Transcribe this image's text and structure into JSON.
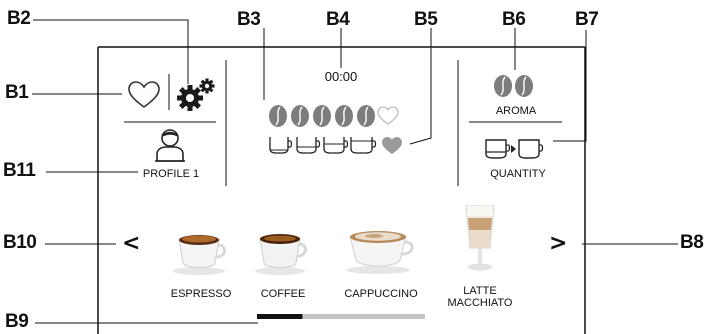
{
  "callouts": {
    "b1": "B1",
    "b2": "B2",
    "b3": "B3",
    "b4": "B4",
    "b5": "B5",
    "b6": "B6",
    "b7": "B7",
    "b8": "B8",
    "b9": "B9",
    "b10": "B10",
    "b11": "B11"
  },
  "screen": {
    "timer": "00:00",
    "profile_label": "PROFILE 1",
    "aroma_label": "AROMA",
    "quantity_label": "QUANTITY",
    "nav_prev": "<",
    "nav_next": ">",
    "strength_level": 5,
    "strength_max": 6,
    "quantity_level": 4,
    "quantity_max": 5,
    "page_indicator_fraction": 0.27
  },
  "beverages": [
    {
      "label": "ESPRESSO",
      "icon": "espresso-cup-icon"
    },
    {
      "label": "COFFEE",
      "icon": "coffee-cup-icon"
    },
    {
      "label": "CAPPUCCINO",
      "icon": "cappuccino-cup-icon"
    },
    {
      "label": "LATTE\nMACCHIATO",
      "icon": "latte-macchiato-glass-icon"
    }
  ],
  "icons": {
    "favorite": "heart-icon",
    "settings": "gears-icon",
    "profile": "user-avatar-icon",
    "bean": "coffee-bean-icon",
    "cup": "cup-icon"
  },
  "colors": {
    "bean": "#7d7d7d",
    "heart_filled": "#9a9a9a",
    "indicator_active": "#111111",
    "indicator_track": "#c4c4c4"
  }
}
